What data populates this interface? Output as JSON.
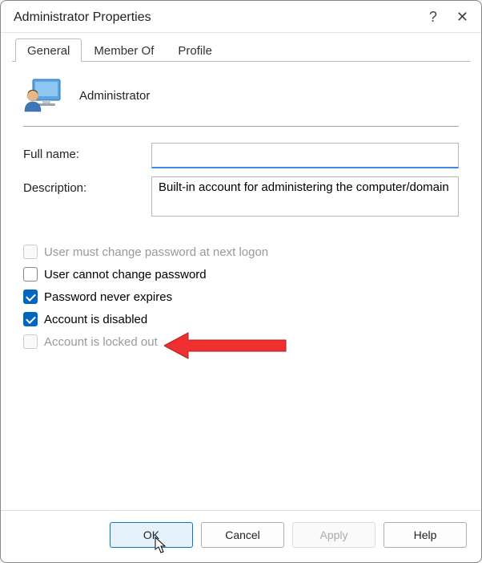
{
  "window": {
    "title": "Administrator Properties",
    "help_label": "?",
    "close_label": "✕"
  },
  "tabs": {
    "items": [
      {
        "label": "General",
        "active": true
      },
      {
        "label": "Member Of",
        "active": false
      },
      {
        "label": "Profile",
        "active": false
      }
    ]
  },
  "account": {
    "name": "Administrator"
  },
  "fields": {
    "full_name_label": "Full name:",
    "full_name_value": "",
    "description_label": "Description:",
    "description_value": "Built-in account for administering the computer/domain"
  },
  "checkboxes": [
    {
      "label": "User must change password at next logon",
      "checked": false,
      "enabled": false
    },
    {
      "label": "User cannot change password",
      "checked": false,
      "enabled": true
    },
    {
      "label": "Password never expires",
      "checked": true,
      "enabled": true
    },
    {
      "label": "Account is disabled",
      "checked": true,
      "enabled": true
    },
    {
      "label": "Account is locked out",
      "checked": false,
      "enabled": false
    }
  ],
  "buttons": {
    "ok": "OK",
    "cancel": "Cancel",
    "apply": "Apply",
    "help": "Help"
  },
  "colors": {
    "accent": "#0067c0",
    "focus": "#3a8de0",
    "arrow": "#ef3030"
  }
}
